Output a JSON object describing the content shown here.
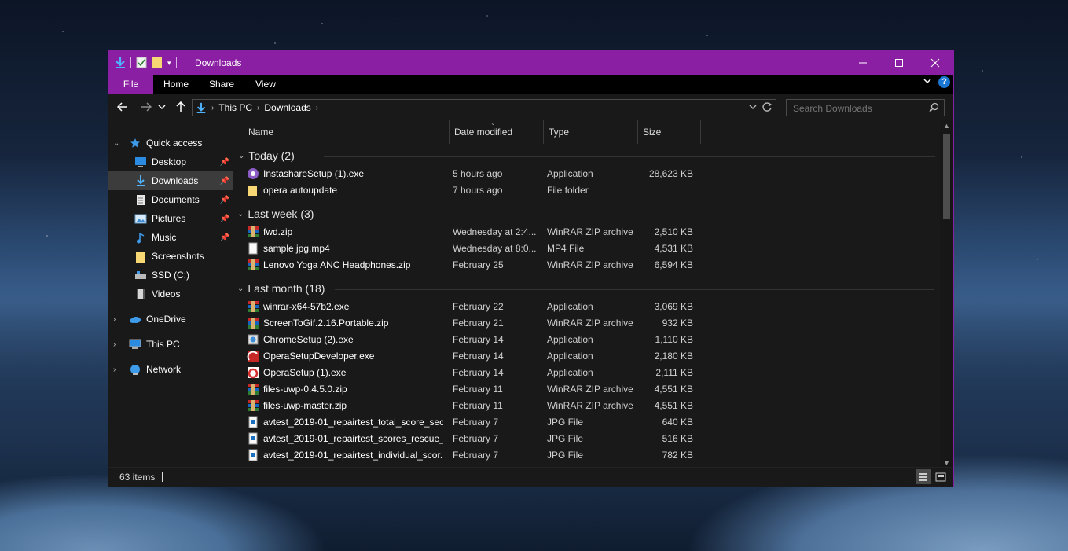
{
  "window": {
    "title": "Downloads"
  },
  "ribbon": {
    "tabs": [
      "File",
      "Home",
      "Share",
      "View"
    ],
    "help_label": "?"
  },
  "address": {
    "crumbs": [
      "This PC",
      "Downloads"
    ]
  },
  "search": {
    "placeholder": "Search Downloads"
  },
  "sidebar": {
    "items": [
      {
        "label": "Quick access",
        "icon": "star-icon"
      },
      {
        "label": "Desktop",
        "icon": "desktop-icon"
      },
      {
        "label": "Downloads",
        "icon": "download-icon"
      },
      {
        "label": "Documents",
        "icon": "document-icon"
      },
      {
        "label": "Pictures",
        "icon": "pictures-icon"
      },
      {
        "label": "Music",
        "icon": "music-icon"
      },
      {
        "label": "Screenshots",
        "icon": "folder-icon"
      },
      {
        "label": "SSD (C:)",
        "icon": "drive-icon"
      },
      {
        "label": "Videos",
        "icon": "video-icon"
      },
      {
        "label": "OneDrive",
        "icon": "cloud-icon"
      },
      {
        "label": "This PC",
        "icon": "computer-icon"
      },
      {
        "label": "Network",
        "icon": "network-icon"
      }
    ]
  },
  "columns": [
    "Name",
    "Date modified",
    "Type",
    "Size"
  ],
  "groups": [
    {
      "label": "Today (2)",
      "files": [
        {
          "name": "InstashareSetup (1).exe",
          "date": "5 hours ago",
          "type": "Application",
          "size": "28,623 KB",
          "icon": "instashare-icon"
        },
        {
          "name": "opera autoupdate",
          "date": "7 hours ago",
          "type": "File folder",
          "size": "",
          "icon": "folder-icon"
        }
      ]
    },
    {
      "label": "Last week (3)",
      "files": [
        {
          "name": "fwd.zip",
          "date": "Wednesday at 2:4...",
          "type": "WinRAR ZIP archive",
          "size": "2,510 KB",
          "icon": "winrar-icon"
        },
        {
          "name": "sample jpg.mp4",
          "date": "Wednesday at 8:0...",
          "type": "MP4 File",
          "size": "4,531 KB",
          "icon": "file-icon"
        },
        {
          "name": "Lenovo Yoga ANC Headphones.zip",
          "date": "February 25",
          "type": "WinRAR ZIP archive",
          "size": "6,594 KB",
          "icon": "winrar-icon"
        }
      ]
    },
    {
      "label": "Last month (18)",
      "files": [
        {
          "name": "winrar-x64-57b2.exe",
          "date": "February 22",
          "type": "Application",
          "size": "3,069 KB",
          "icon": "winrar-icon"
        },
        {
          "name": "ScreenToGif.2.16.Portable.zip",
          "date": "February 21",
          "type": "WinRAR ZIP archive",
          "size": "932 KB",
          "icon": "winrar-icon"
        },
        {
          "name": "ChromeSetup (2).exe",
          "date": "February 14",
          "type": "Application",
          "size": "1,110 KB",
          "icon": "setup-icon"
        },
        {
          "name": "OperaSetupDeveloper.exe",
          "date": "February 14",
          "type": "Application",
          "size": "2,180 KB",
          "icon": "opera-dev-icon"
        },
        {
          "name": "OperaSetup (1).exe",
          "date": "February 14",
          "type": "Application",
          "size": "2,111 KB",
          "icon": "opera-icon"
        },
        {
          "name": "files-uwp-0.4.5.0.zip",
          "date": "February 11",
          "type": "WinRAR ZIP archive",
          "size": "4,551 KB",
          "icon": "winrar-icon"
        },
        {
          "name": "files-uwp-master.zip",
          "date": "February 11",
          "type": "WinRAR ZIP archive",
          "size": "4,551 KB",
          "icon": "winrar-icon"
        },
        {
          "name": "avtest_2019-01_repairtest_total_score_sec...",
          "date": "February 7",
          "type": "JPG File",
          "size": "640 KB",
          "icon": "jpg-icon"
        },
        {
          "name": "avtest_2019-01_repairtest_scores_rescue_t...",
          "date": "February 7",
          "type": "JPG File",
          "size": "516 KB",
          "icon": "jpg-icon"
        },
        {
          "name": "avtest_2019-01_repairtest_individual_scor...",
          "date": "February 7",
          "type": "JPG File",
          "size": "782 KB",
          "icon": "jpg-icon"
        }
      ]
    }
  ],
  "status": {
    "item_count": "63 items"
  },
  "colors": {
    "accent": "#8b1fa3",
    "background": "#191919",
    "selected": "#3c3c3c"
  }
}
